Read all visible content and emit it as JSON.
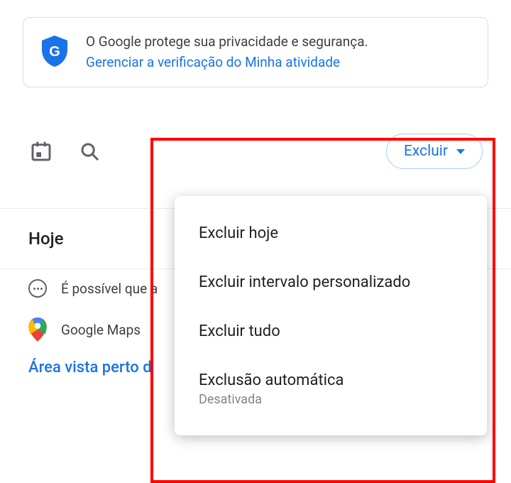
{
  "banner": {
    "text": "O Google protege sua privacidade e segurança.",
    "link": "Gerenciar a verificação do Minha atividade"
  },
  "toolbar": {
    "delete_label": "Excluir"
  },
  "section": {
    "today": "Hoje"
  },
  "activity": {
    "row1": "É possível que a",
    "row2": "Google Maps"
  },
  "link": {
    "area": "Área vista perto d"
  },
  "menu": {
    "items": [
      {
        "label": "Excluir hoje",
        "sub": ""
      },
      {
        "label": "Excluir intervalo personalizado",
        "sub": ""
      },
      {
        "label": "Excluir tudo",
        "sub": ""
      },
      {
        "label": "Exclusão automática",
        "sub": "Desativada"
      }
    ]
  }
}
